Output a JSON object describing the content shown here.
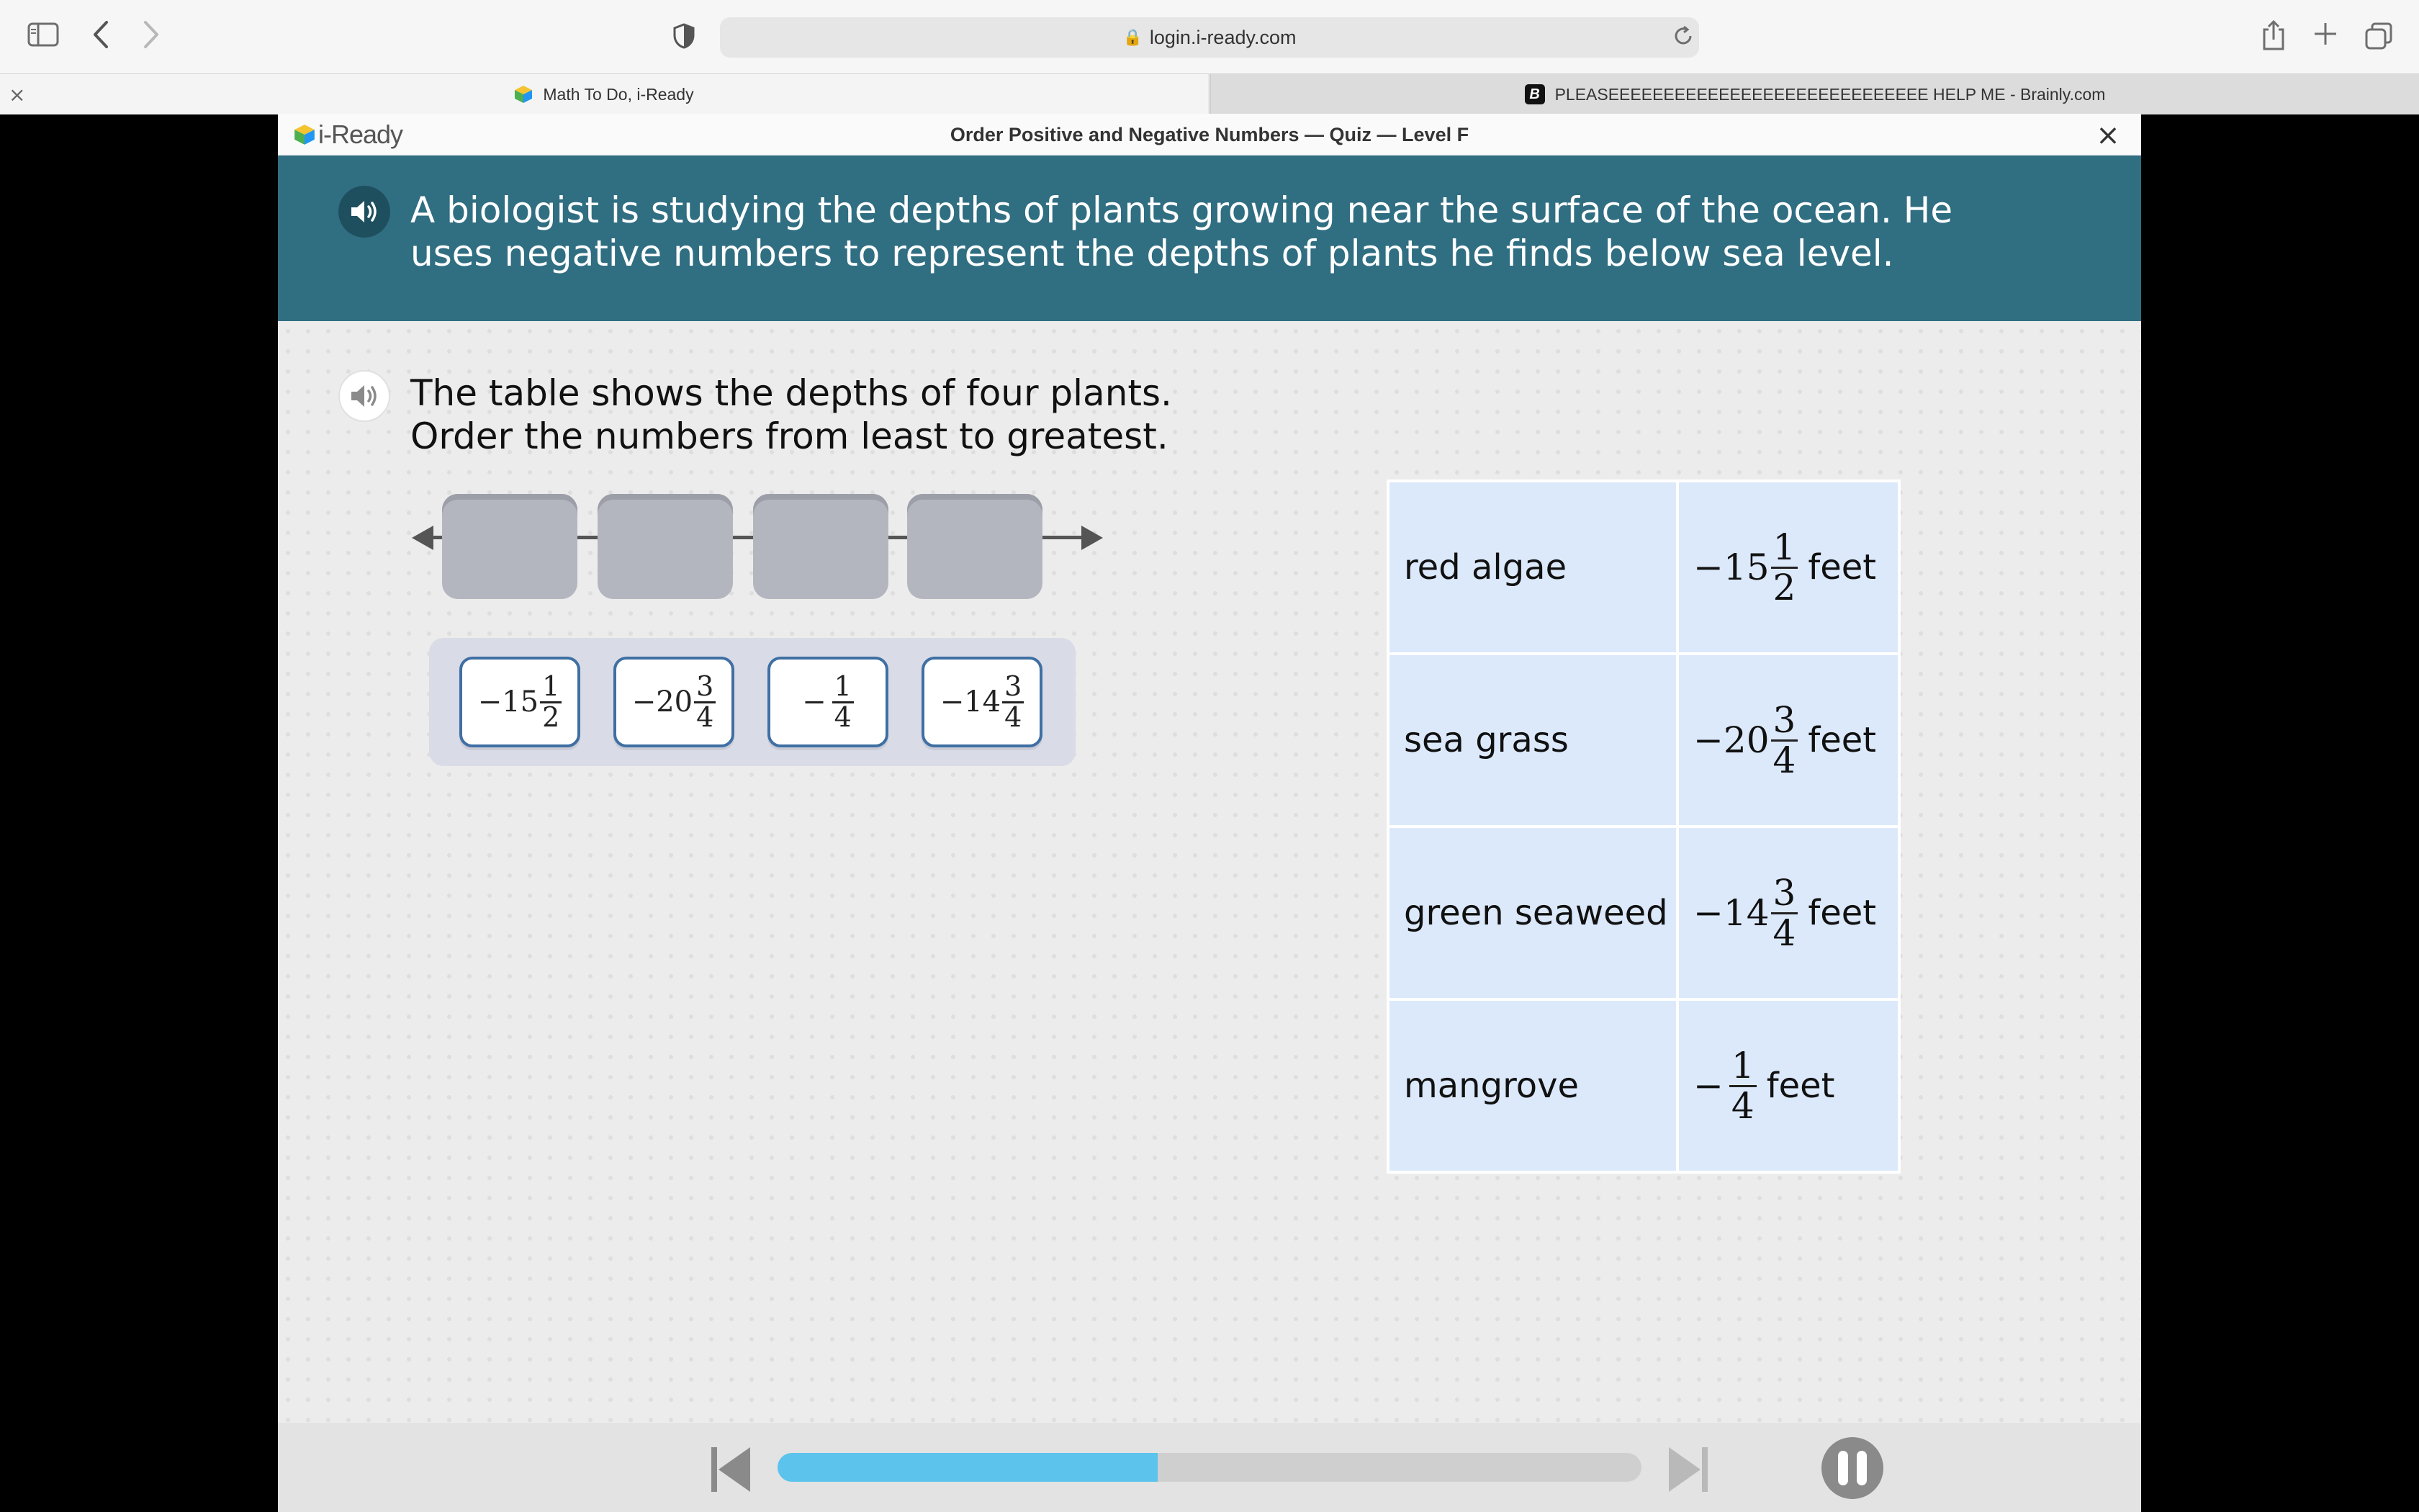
{
  "browser": {
    "url": "login.i-ready.com",
    "tabs": [
      {
        "title": "Math To Do, i-Ready",
        "active": true
      },
      {
        "title": "PLEASEEEEEEEEEEEEEEEEEEEEEEEEEEEEE HELP ME - Brainly.com",
        "active": false
      }
    ],
    "tab_close_label": "×"
  },
  "app": {
    "logo_text": "i-Ready",
    "quiz_title": "Order Positive and Negative Numbers — Quiz — Level F",
    "close_label": "×",
    "banner_text": "A biologist is studying the depths of plants growing near the surface of the ocean. He uses negative numbers to represent the depths of plants he finds below sea level.",
    "prompt_line1": "The table shows the depths of four plants.",
    "prompt_line2": "Order the numbers from least to greatest.",
    "tiles": [
      {
        "sign": "−",
        "whole": "15",
        "num": "1",
        "den": "2"
      },
      {
        "sign": "−",
        "whole": "20",
        "num": "3",
        "den": "4"
      },
      {
        "sign": "−",
        "whole": "",
        "num": "1",
        "den": "4"
      },
      {
        "sign": "−",
        "whole": "14",
        "num": "3",
        "den": "4"
      }
    ],
    "table": [
      {
        "plant": "red algae",
        "sign": "−",
        "whole": "15",
        "num": "1",
        "den": "2",
        "unit": "feet"
      },
      {
        "plant": "sea grass",
        "sign": "−",
        "whole": "20",
        "num": "3",
        "den": "4",
        "unit": "feet"
      },
      {
        "plant": "green seaweed",
        "sign": "−",
        "whole": "14",
        "num": "3",
        "den": "4",
        "unit": "feet"
      },
      {
        "plant": "mangrove",
        "sign": "−",
        "whole": "",
        "num": "1",
        "den": "4",
        "unit": "feet"
      }
    ],
    "progress_fraction": 0.44,
    "colors": {
      "banner": "#306e82",
      "progress": "#5bc3ec",
      "tile_border": "#3f6fa3",
      "table_cell": "#dce9fb"
    }
  }
}
